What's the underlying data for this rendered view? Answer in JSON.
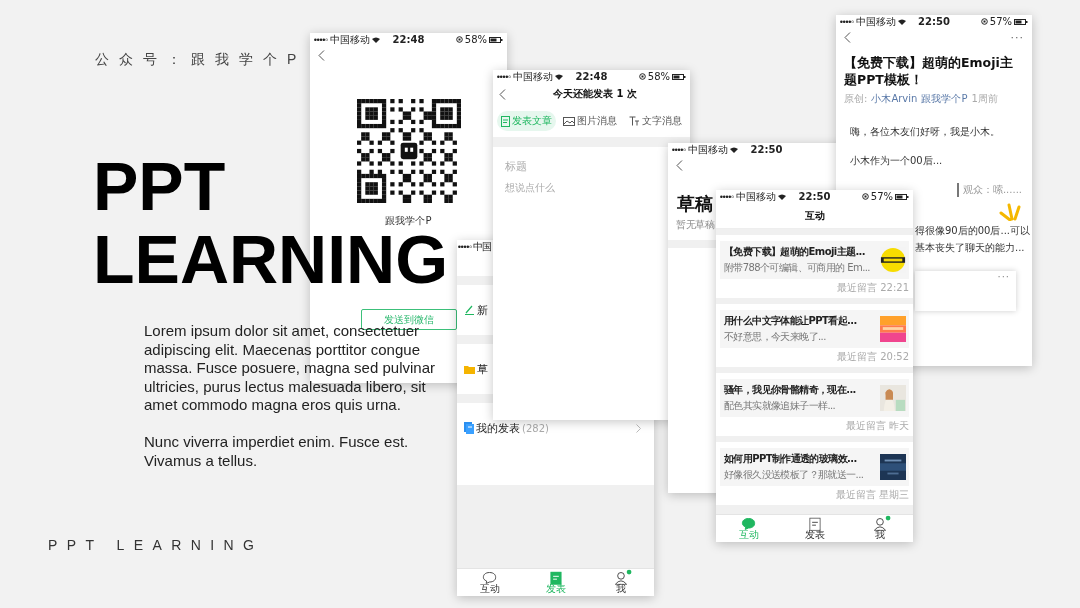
{
  "slide": {
    "account": "公众号：跟我学个P",
    "headline": [
      "PPT",
      "LEARNING"
    ],
    "body": [
      "Lorem ipsum dolor sit amet, consectetuer adipiscing elit. Maecenas porttitor congue massa. Fusce posuere, magna sed pulvinar ultricies, purus lectus malesuada libero, sit amet commodo magna eros quis urna.",
      "Nunc viverra imperdiet enim. Fusce est. Vivamus a tellus."
    ],
    "footer": "PPT LEARNING"
  },
  "phones": [
    {
      "kind": "qr",
      "status": {
        "carrier": "中国移动",
        "time": "22:48",
        "battery": "58%"
      },
      "account": "跟我学个P",
      "button": "发送到微信"
    },
    {
      "kind": "menu",
      "status": {
        "carrier": "中国"
      },
      "items": [
        {
          "label": "新"
        },
        {
          "label": "草"
        },
        {
          "label": "我的发表",
          "count": "(282)"
        }
      ],
      "tabs": [
        {
          "label": "互动",
          "selected": false,
          "badge": false
        },
        {
          "label": "发表",
          "selected": true,
          "badge": false
        },
        {
          "label": "我",
          "selected": false,
          "badge": true
        }
      ]
    },
    {
      "kind": "compose",
      "status": {
        "carrier": "中国移动",
        "time": "22:48",
        "battery": "58%"
      },
      "title": "今天还能发表 1 次",
      "tabs": [
        {
          "label": "发表文章",
          "selected": true
        },
        {
          "label": "图片消息",
          "selected": false
        },
        {
          "label": "文字消息",
          "selected": false
        }
      ],
      "title_placeholder": "标题",
      "body_placeholder": "想说点什么"
    },
    {
      "kind": "drafts",
      "status": {
        "carrier": "中国移动",
        "time": "22:50"
      },
      "heading": "草稿",
      "note": "暂无草稿"
    },
    {
      "kind": "article",
      "status": {
        "carrier": "中国移动",
        "time": "22:50",
        "battery": "57%"
      },
      "more": "···",
      "title": "【免费下载】超萌的Emoji主题PPT模板！",
      "meta": {
        "label": "原创:",
        "author": "小木Arvin",
        "account": "跟我学个P",
        "time": "1周前"
      },
      "paragraphs": [
        "嗨，各位木友们好呀，我是小木。",
        "小木作为一个00后..."
      ],
      "quote": "观众：嗦......",
      "tail": [
        "得很像90后的00后...可以",
        "基本丧失了聊天的能力..."
      ],
      "card_more": "···"
    },
    {
      "kind": "interact",
      "status": {
        "carrier": "中国移动",
        "time": "22:50",
        "battery": "57%"
      },
      "title": "互动",
      "cards": [
        {
          "title": "【免费下载】超萌的Emoji主题...",
          "excerpt": "附带788个可编辑、可商用的 Em...",
          "time": "最近留言 22:21"
        },
        {
          "title": "用什么中文字体能让PPT看起...",
          "excerpt": "不好意思，今天来晚了...",
          "time": "最近留言 20:52"
        },
        {
          "title": "骚年，我见你骨骼精奇，现在...",
          "excerpt": "配色其实就像追妹子一样...",
          "time": "最近留言 昨天"
        },
        {
          "title": "如何用PPT制作通透的玻璃效...",
          "excerpt": "好像很久没送模板了？那就送一...",
          "time": "最近留言 星期三"
        }
      ],
      "tabs": [
        {
          "label": "互动",
          "selected": true,
          "badge": false
        },
        {
          "label": "发表",
          "selected": false,
          "badge": false
        },
        {
          "label": "我",
          "selected": false,
          "badge": true
        }
      ]
    }
  ]
}
